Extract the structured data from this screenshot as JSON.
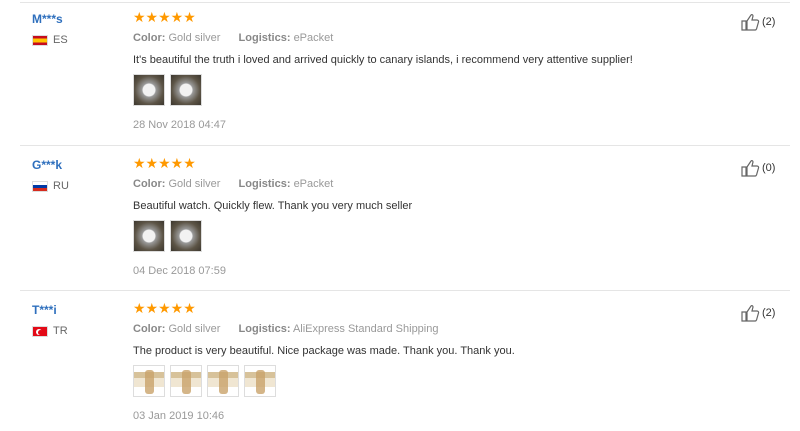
{
  "labels": {
    "color": "Color:",
    "logistics": "Logistics:"
  },
  "reviews": [
    {
      "buyer": "M***s",
      "country": "ES",
      "stars": "★★★★★",
      "color": "Gold silver",
      "logistics": "ePacket",
      "text": "It's beautiful the truth i loved and arrived quickly to canary islands, i recommend very attentive supplier!",
      "date": "28 Nov 2018 04:47",
      "likes": "(2)"
    },
    {
      "buyer": "G***k",
      "country": "RU",
      "stars": "★★★★★",
      "color": "Gold silver",
      "logistics": "ePacket",
      "text": "Beautiful watch. Quickly flew. Thank you very much seller",
      "date": "04 Dec 2018 07:59",
      "likes": "(0)"
    },
    {
      "buyer": "T***i",
      "country": "TR",
      "stars": "★★★★★",
      "color": "Gold silver",
      "logistics": "AliExpress Standard Shipping",
      "text": "The product is very beautiful. Nice package was made. Thank you. Thank you.",
      "date": "03 Jan 2019 10:46",
      "likes": "(2)"
    }
  ],
  "icons": {
    "like": "thumbs-up-icon",
    "star": "star-icon"
  },
  "colors": {
    "buyer_name": "#2e6fbd",
    "stars": "#ff9900"
  }
}
